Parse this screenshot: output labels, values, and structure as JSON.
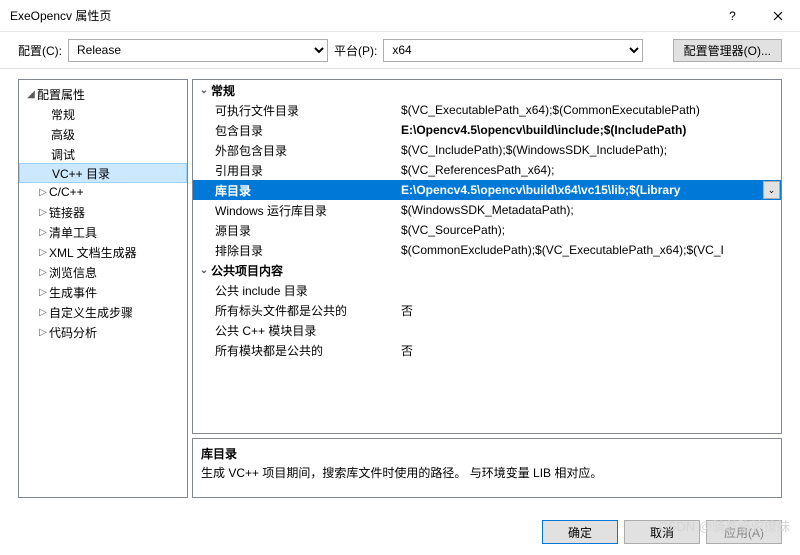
{
  "window": {
    "title": "ExeOpencv 属性页",
    "help": "?",
    "close": "×"
  },
  "toolbar": {
    "config_label": "配置(C):",
    "config_value": "Release",
    "platform_label": "平台(P):",
    "platform_value": "x64",
    "manager_button": "配置管理器(O)..."
  },
  "tree": {
    "root": "配置属性",
    "items": [
      "常规",
      "高级",
      "调试",
      "VC++ 目录"
    ],
    "expandable": [
      "C/C++",
      "链接器",
      "清单工具",
      "XML 文档生成器",
      "浏览信息",
      "生成事件",
      "自定义生成步骤",
      "代码分析"
    ],
    "selected": "VC++ 目录"
  },
  "grid": {
    "group1": "常规",
    "rows": [
      {
        "name": "可执行文件目录",
        "value": "$(VC_ExecutablePath_x64);$(CommonExecutablePath)"
      },
      {
        "name": "包含目录",
        "value": "E:\\Opencv4.5\\opencv\\build\\include;$(IncludePath)",
        "bold": true
      },
      {
        "name": "外部包含目录",
        "value": "$(VC_IncludePath);$(WindowsSDK_IncludePath);"
      },
      {
        "name": "引用目录",
        "value": "$(VC_ReferencesPath_x64);"
      },
      {
        "name": "库目录",
        "value": "E:\\Opencv4.5\\opencv\\build\\x64\\vc15\\lib;$(Library",
        "selected": true
      },
      {
        "name": "Windows 运行库目录",
        "value": "$(WindowsSDK_MetadataPath);"
      },
      {
        "name": "源目录",
        "value": "$(VC_SourcePath);"
      },
      {
        "name": "排除目录",
        "value": "$(CommonExcludePath);$(VC_ExecutablePath_x64);$(VC_I"
      }
    ],
    "group2": "公共项目内容",
    "rows2": [
      {
        "name": "公共 include 目录",
        "value": ""
      },
      {
        "name": "所有标头文件都是公共的",
        "value": "否"
      },
      {
        "name": "公共 C++ 模块目录",
        "value": ""
      },
      {
        "name": "所有模块都是公共的",
        "value": "否"
      }
    ]
  },
  "description": {
    "title": "库目录",
    "text": "生成 VC++ 项目期间，搜索库文件时使用的路径。 与环境变量 LIB 相对应。"
  },
  "footer": {
    "ok": "确定",
    "cancel": "取消",
    "apply": "应用(A)"
  },
  "watermark": "CSDN @骑着骆驼撩妹"
}
